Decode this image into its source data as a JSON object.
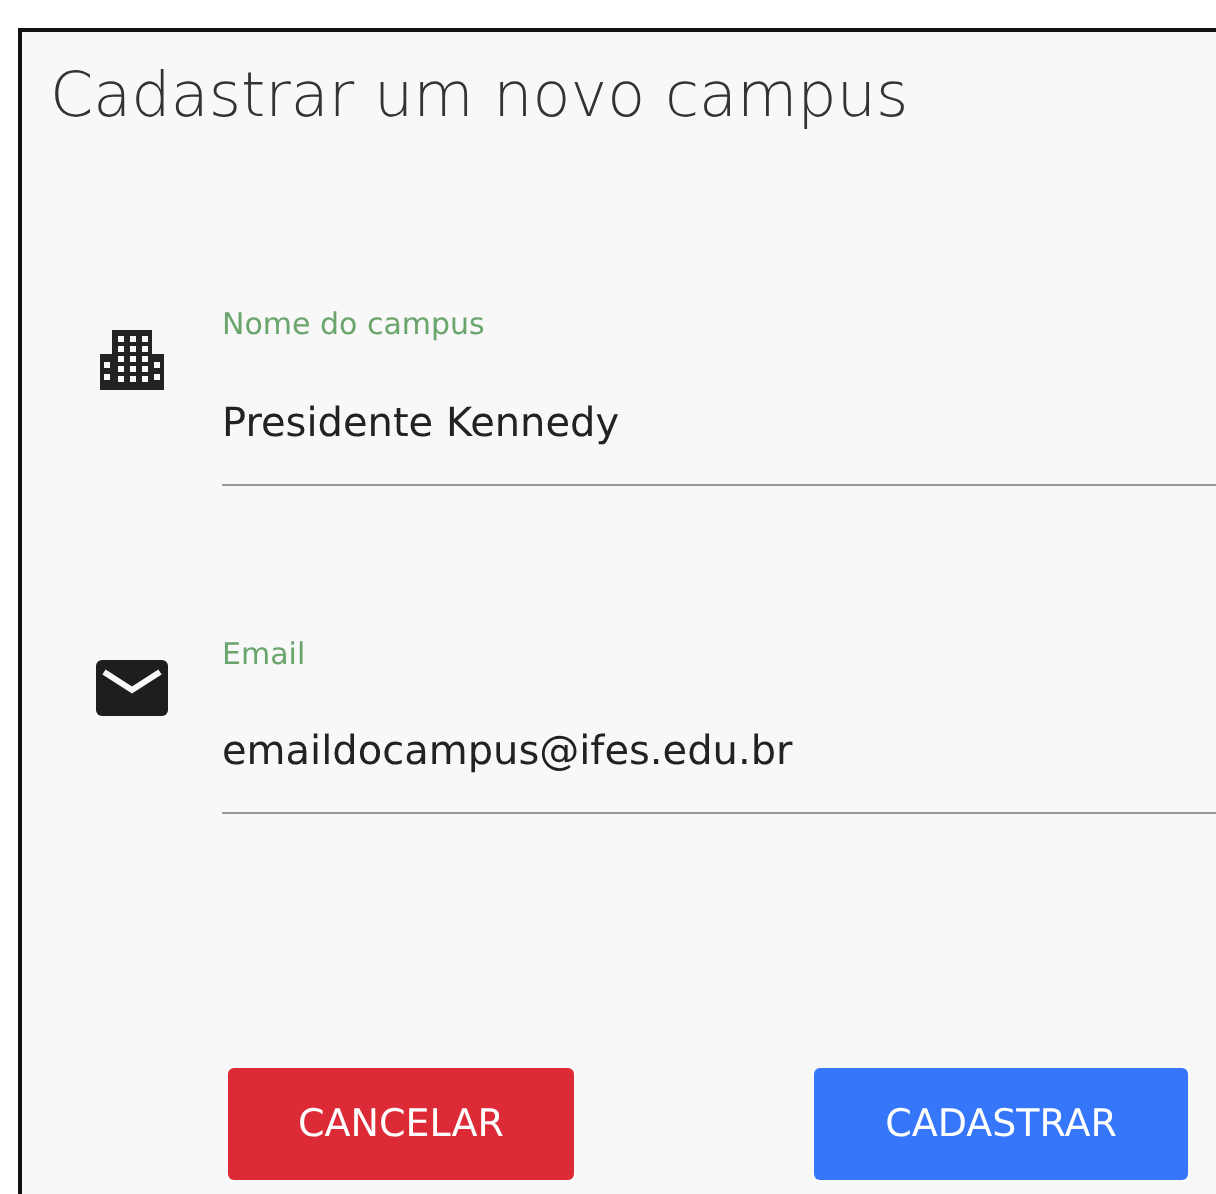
{
  "title": "Cadastrar um novo campus",
  "fields": [
    {
      "label": "Nome do campus",
      "value": "Presidente Kennedy",
      "kind": "building"
    },
    {
      "label": "Email",
      "value": "emaildocampus@ifes.edu.br",
      "kind": "email"
    }
  ],
  "buttons": [
    {
      "label": "CANCELAR",
      "kind": "danger"
    },
    {
      "label": "CADASTRAR",
      "kind": "primary"
    }
  ]
}
